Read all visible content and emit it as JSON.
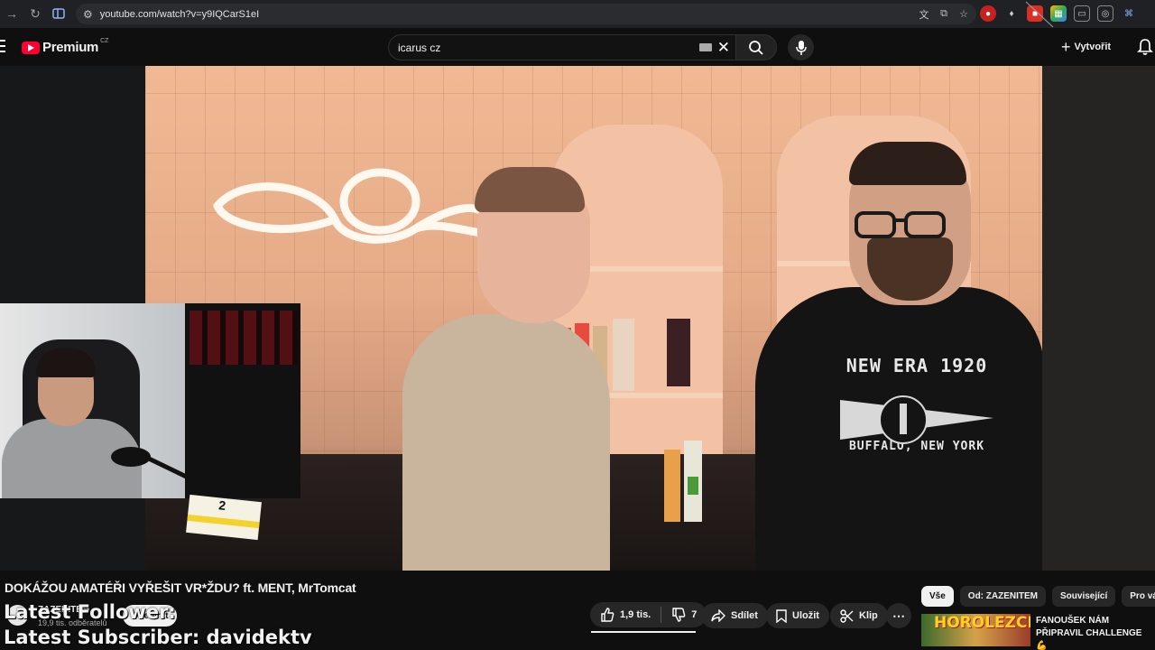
{
  "browser": {
    "url": "youtube.com/watch?v=y9IQCarS1eI"
  },
  "header": {
    "brand": "Premium",
    "region": "CZ",
    "search_value": "icarus cz",
    "create_label": "Vytvořit"
  },
  "video": {
    "shirt_line1": "NEW ERA 1920",
    "shirt_line2": "BUFFALO, NEW YORK",
    "sticky_number": "2"
  },
  "overlay": {
    "line1": "Latest Follower:",
    "line2": "Latest Subscriber: davidektv"
  },
  "details": {
    "title": "DOKÁŽOU AMATÉŘI VYŘEŠIT VR*ŽDU? ft. MENT, MrTomcat",
    "channel_name": "ZAZENITEM",
    "subscribers": "19,9 tis. odběratelů",
    "subscribe_label": "Odebírat",
    "likes": "1,9 tis.",
    "dislikes": "7",
    "share_label": "Sdílet",
    "save_label": "Uložit",
    "clip_label": "Klip"
  },
  "sidebar": {
    "chips": [
      {
        "label": "Vše",
        "active": true
      },
      {
        "label": "Od: ZAZENITEM",
        "active": false
      },
      {
        "label": "Související",
        "active": false
      },
      {
        "label": "Pro vás",
        "active": false
      }
    ],
    "rec_thumb_text": "HOROLEZCI",
    "rec_title": "FANOUŠEK NÁM PŘIPRAVIL CHALLENGE 💪"
  },
  "colors": {
    "brand_red": "#ff0033",
    "background": "#0f0f0f",
    "pill": "#272727"
  }
}
